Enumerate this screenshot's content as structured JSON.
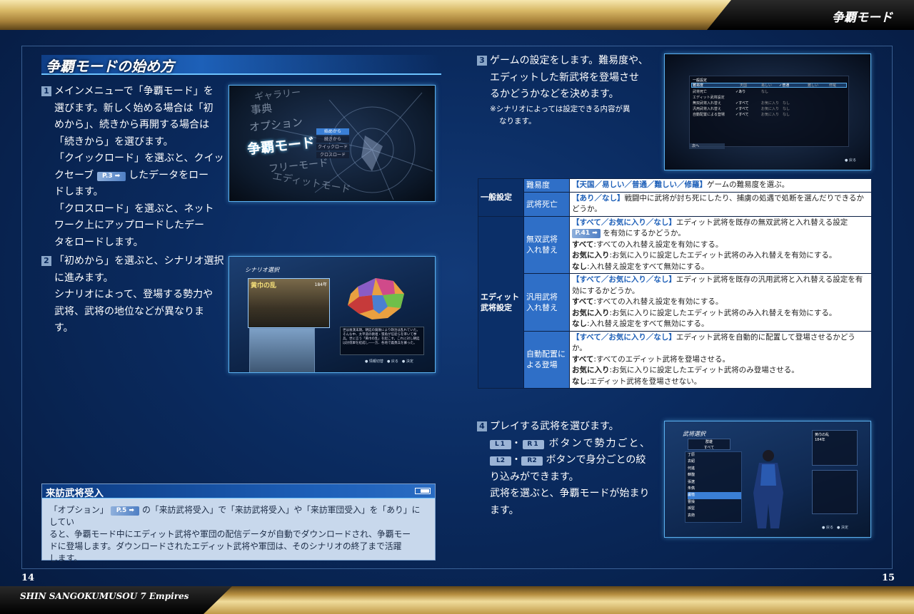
{
  "header": {
    "title": "争覇モード"
  },
  "footer": {
    "title": "SHIN SANGOKUMUSOU 7 Empires",
    "page_left": "14",
    "page_right": "15"
  },
  "section": {
    "title": "争覇モードの始め方"
  },
  "step1": {
    "num": "1",
    "l1": "メインメニューで「争覇モード」を",
    "l2": "選びます。新しく始める場合は「初",
    "l3": "めから」、続きから再開する場合は",
    "l4": "「続きから」を選びます。",
    "l5": "「クイックロード」を選ぶと、クイッ",
    "l6a": "クセーブ",
    "l6ref": "P.3",
    "l6b": "したデータをロー",
    "l7": "ドします。",
    "l8": "「クロスロード」を選ぶと、ネット",
    "l9": "ワーク上にアップロードしたデー",
    "l10": "タをロードします。"
  },
  "step2": {
    "num": "2",
    "l1": "「初めから」を選ぶと、シナリオ選択",
    "l2": "に進みます。",
    "l3": "シナリオによって、登場する勢力や",
    "l4": "武将、武将の地位などが異なりま",
    "l5": "す。"
  },
  "step3": {
    "num": "3",
    "l1": "ゲームの設定をします。難易度や、",
    "l2": "エディットした新武将を登場させ",
    "l3": "るかどうかなどを決めます。",
    "note1": "※シナリオによっては設定できる内容が異",
    "note2": "なります。"
  },
  "step4": {
    "num": "4",
    "l1": "プレイする武将を選びます。",
    "btn_l1": "L1",
    "btn_r1": "R1",
    "l2": "ボタンで勢力ごと、",
    "btn_l2": "L2",
    "btn_r2": "R2",
    "l3": "ボタンで身分ごとの絞",
    "l4": "り込みができます。",
    "l5": "武将を選ぶと、争覇モードが始まり",
    "l6": "ます。",
    "dot": "・"
  },
  "infobox": {
    "title": "来訪武将受入",
    "b1a": "「オプション」",
    "b1ref": "P.5",
    "b1b": "の「来訪武将受入」で「来訪武将受入」や「来訪軍団受入」を「あり」にしてい",
    "b2": "ると、争覇モード中にエディット武将や軍団の配信データが自動でダウンロードされ、争覇モー",
    "b3": "ドに登場します。ダウンロードされたエディット武将や軍団は、そのシナリオの終了まで活躍",
    "b4": "します。"
  },
  "settings_table": {
    "general": "一般設定",
    "edit_a": "エディット",
    "edit_b": "武将設定",
    "r1_label": "難易度",
    "r1_opts": "【天国／易しい／普通／難しい／修羅】",
    "r1_desc": "ゲームの難易度を選ぶ。",
    "r2_label": "武将死亡",
    "r2_opts": "【あり／なし】",
    "r2_desc": "戦闘中に武将が討ち死にしたり、捕虜の処遇で処断を選んだりできるかどうか。",
    "r3_label_a": "無双武将",
    "r3_label_b": "入れ替え",
    "r3_opts": "【すべて／お気に入り／なし】",
    "r3_desc1": "エディット武将を既存の無双武将と入れ替える設定",
    "r3_ref": "P.41",
    "r3_desc2": "を有効にするかどうか。",
    "r3_k1": "すべて",
    "r3_v1": ":すべての入れ替え設定を有効にする。",
    "r3_k2": "お気に入り",
    "r3_v2": ":お気に入りに設定したエディット武将のみ入れ替えを有効にする。",
    "r3_k3": "なし",
    "r3_v3": ":入れ替え設定をすべて無効にする。",
    "r4_label_a": "汎用武将",
    "r4_label_b": "入れ替え",
    "r4_opts": "【すべて／お気に入り／なし】",
    "r4_desc1": "エディット武将を既存の汎用武将と入れ替える設定を有効にするかどうか。",
    "r4_k1": "すべて",
    "r4_v1": ":すべての入れ替え設定を有効にする。",
    "r4_k2": "お気に入り",
    "r4_v2": ":お気に入りに設定したエディット武将のみ入れ替えを有効にする。",
    "r4_k3": "なし",
    "r4_v3": ":入れ替え設定をすべて無効にする。",
    "r5_label_a": "自動配置に",
    "r5_label_b": "よる登場",
    "r5_opts": "【すべて／お気に入り／なし】",
    "r5_desc1": "エディット武将を自動的に配置して登場させるかどうか。",
    "r5_k1": "すべて",
    "r5_v1": ":すべてのエディット武将を登場させる。",
    "r5_k2": "お気に入り",
    "r5_v2": ":お気に入りに設定したエディット武将のみ登場させる。",
    "r5_k3": "なし",
    "r5_v3": ":エディット武将を登場させない。"
  },
  "shot1": {
    "menu": [
      "ギャラリー",
      "事典",
      "オプション",
      "争覇モード",
      "フリーモード",
      "エディットモード"
    ],
    "sub": [
      "始めから",
      "続きから",
      "クイックロード",
      "クロスロード"
    ]
  },
  "shot2": {
    "title": "シナリオ選択",
    "scenario": "黄巾の乱",
    "year": "184年",
    "desc": "世は後漢末期。朝廷の腐敗により政治は乱れていた。そんな中、太平道の教祖・張角が信徒らを率いて挙兵。世に言う「黄巾の乱」を起こす。これに対し朝廷は討伐軍を結成し――方、各地で義勇兵を募った。",
    "foot": "● 情報切替　● 戻る　● 決定"
  },
  "shot3": {
    "head": "一般設定",
    "r1": "難易度",
    "r1v": [
      "天国",
      "易しい",
      "✓普通",
      "難しい",
      "修羅"
    ],
    "r2": "武将死亡",
    "r2v": [
      "✓あり",
      "なし"
    ],
    "sub": "エディット武将設定",
    "r3": "無双武将入れ替え",
    "r4": "汎用武将入れ替え",
    "r5": "自動配置による登場",
    "rv": [
      "✓すべて",
      "お気に入り",
      "なし"
    ],
    "next": "次へ",
    "back": "● 戻る"
  },
  "shot4": {
    "title": "武将選択",
    "filter1": "群雄",
    "filter2": "すべて",
    "names": [
      "丁原",
      "袁紹",
      "何進",
      "韓馥",
      "張遼",
      "朱儁",
      "盧植",
      "曹操",
      "孫堅",
      "袁術"
    ],
    "scenario": "黄巾の乱",
    "year": "184年",
    "foot": "● 戻る　● 決定"
  }
}
